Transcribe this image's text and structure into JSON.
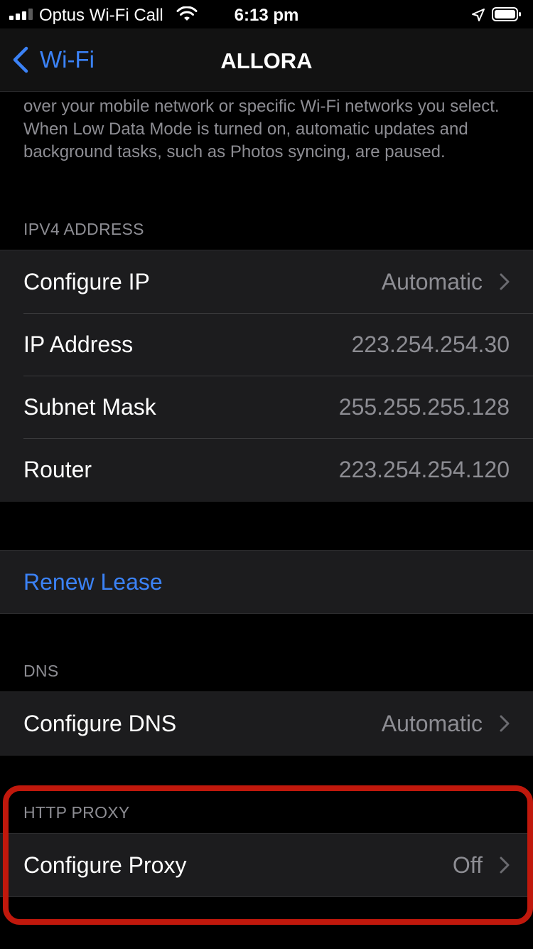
{
  "status_bar": {
    "carrier": "Optus Wi-Fi Call",
    "time": "6:13 pm",
    "icons": [
      "signal-icon",
      "wifi-icon",
      "location-icon",
      "battery-icon"
    ]
  },
  "nav": {
    "back_label": "Wi-Fi",
    "title": "ALLORA"
  },
  "footnote": "over your mobile network or specific Wi-Fi networks you select. When Low Data Mode is turned on, automatic updates and background tasks, such as Photos syncing, are paused.",
  "ipv4": {
    "header": "IPV4 ADDRESS",
    "rows": [
      {
        "label": "Configure IP",
        "value": "Automatic"
      },
      {
        "label": "IP Address",
        "value": "223.254.254.30"
      },
      {
        "label": "Subnet Mask",
        "value": "255.255.255.128"
      },
      {
        "label": "Router",
        "value": "223.254.254.120"
      }
    ]
  },
  "renew": {
    "label": "Renew Lease"
  },
  "dns": {
    "header": "DNS",
    "rows": [
      {
        "label": "Configure DNS",
        "value": "Automatic"
      }
    ]
  },
  "proxy": {
    "header": "HTTP PROXY",
    "rows": [
      {
        "label": "Configure Proxy",
        "value": "Off"
      }
    ]
  },
  "colors": {
    "accent": "#3b82f6",
    "background": "#000000",
    "cell": "#1c1c1e",
    "secondary_text": "#8d8d93",
    "highlight": "#c0180c"
  }
}
